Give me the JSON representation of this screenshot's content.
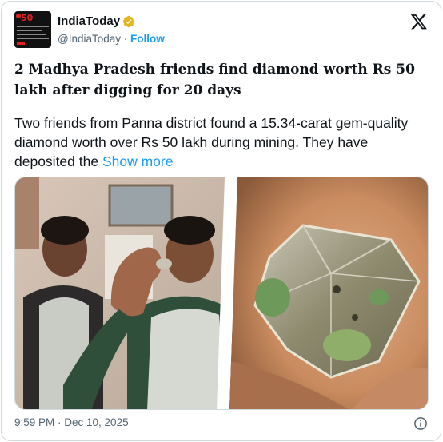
{
  "author": {
    "display_name": "IndiaToday",
    "handle": "@IndiaToday",
    "separator": " · ",
    "follow_label": "Follow",
    "avatar_icon": "india-today-50-logo"
  },
  "post": {
    "headline": "2 Madhya Pradesh friends find diamond worth Rs 50 lakh after digging for 20 days",
    "text": "Two friends from Panna district found a 15.34-carat gem-quality diamond worth over Rs 50 lakh during mining. They have deposited the ",
    "show_more_label": "Show more"
  },
  "media": {
    "description_icon": "diamond-photo"
  },
  "footer": {
    "timestamp": "9:59 PM · Dec 10, 2025"
  },
  "colors": {
    "accent": "#1d9bf0",
    "verified_gold": "#e2b719",
    "text_primary": "#0f1419",
    "text_secondary": "#536471",
    "border": "#cfd9de"
  }
}
